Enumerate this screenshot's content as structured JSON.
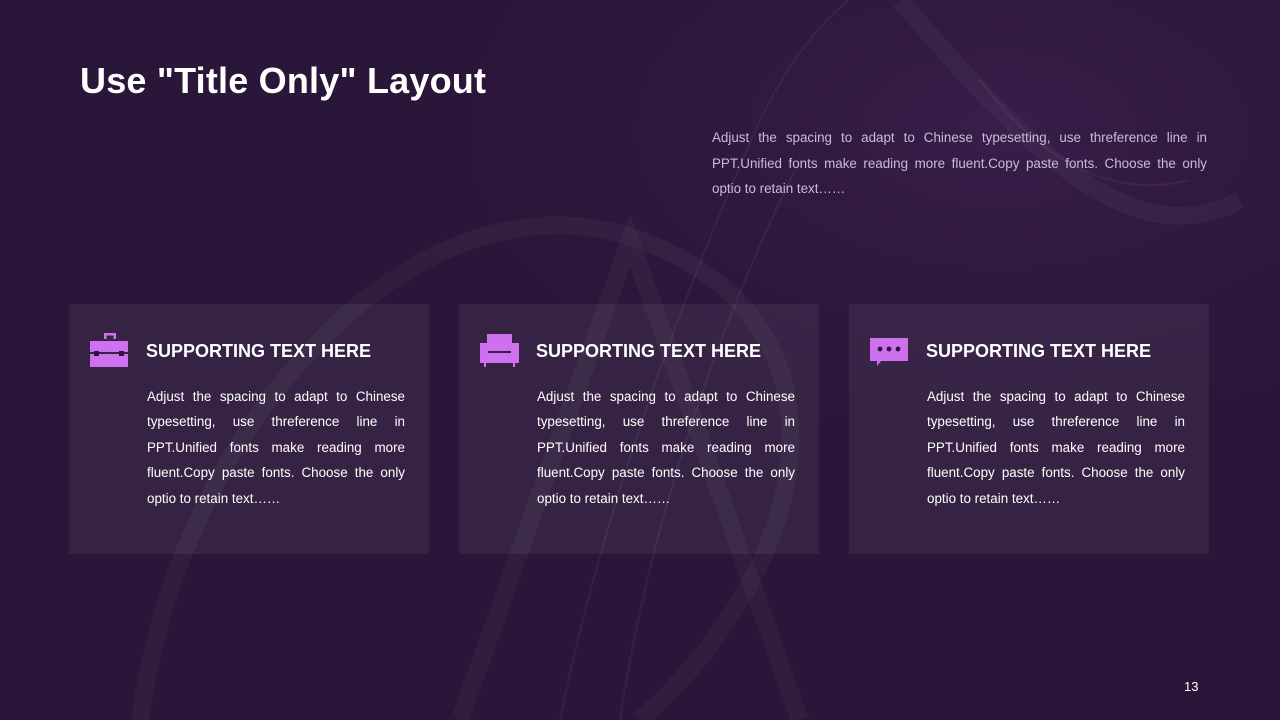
{
  "slide": {
    "title": "Use \"Title Only\" Layout",
    "intro_text": "Adjust the spacing to adapt to Chinese typesetting, use threference line in PPT.Unified fonts make reading more fluent.Copy paste fonts. Choose the only optio to retain text……",
    "page_number": "13"
  },
  "cards": [
    {
      "icon": "toolbox-icon",
      "title": "SUPPORTING TEXT HERE",
      "text": "Adjust the spacing to adapt to Chinese typesetting, use threference line in PPT.Unified fonts make reading more fluent.Copy paste fonts. Choose the only optio to retain text……"
    },
    {
      "icon": "armchair-icon",
      "title": "SUPPORTING TEXT HERE",
      "text": "Adjust the spacing to adapt to Chinese typesetting, use threference line in PPT.Unified fonts make reading more fluent.Copy paste fonts. Choose the only optio to retain text……"
    },
    {
      "icon": "chat-bubble-icon",
      "title": "SUPPORTING TEXT HERE",
      "text": "Adjust the spacing to adapt to Chinese typesetting, use threference line in PPT.Unified fonts make reading more fluent.Copy paste fonts. Choose the only optio to retain text……"
    }
  ],
  "colors": {
    "background": "#2a1638",
    "accent": "#cd71ee",
    "card_background": "rgba(255,255,255,0.06)",
    "intro_text": "#c9bcd4"
  }
}
